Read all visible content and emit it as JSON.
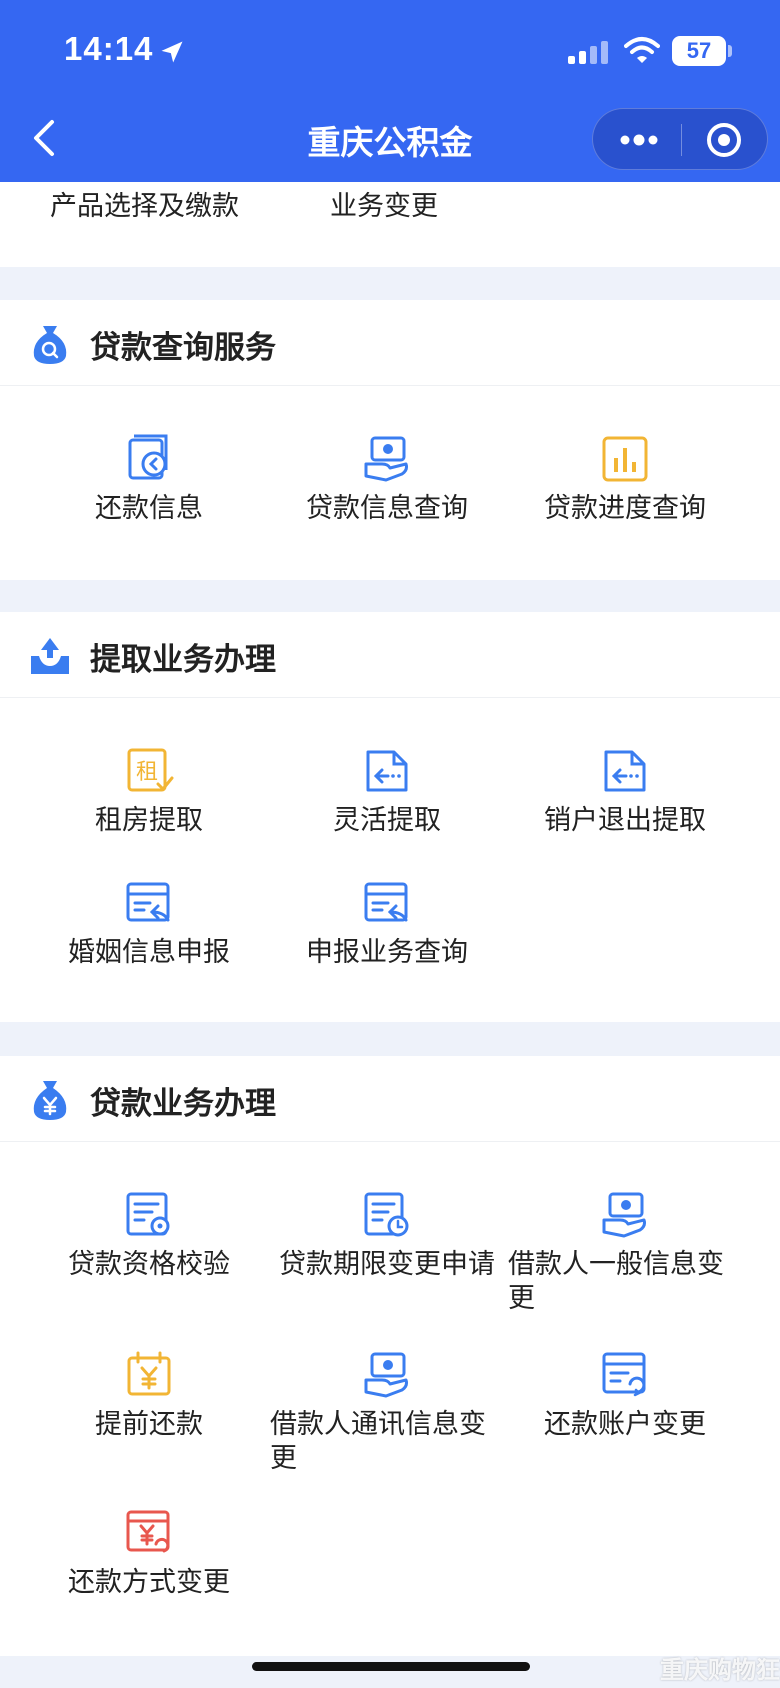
{
  "status_bar": {
    "time": "14:14",
    "battery": "57",
    "location_icon": "location-arrow-icon",
    "signal_icon": "cellular-signal-icon",
    "wifi_icon": "wifi-icon"
  },
  "nav": {
    "title": "重庆公积金",
    "back_icon": "chevron-left-icon",
    "more_icon": "more-dots-icon",
    "close_icon": "target-circle-icon"
  },
  "top_items": [
    "产品选择及缴款",
    "业务变更"
  ],
  "sections": [
    {
      "title": "贷款查询服务",
      "icon": "money-bag-search-icon",
      "items": [
        {
          "label": "还款信息",
          "icon": "repay-info-icon"
        },
        {
          "label": "贷款信息查询",
          "icon": "loan-hand-card-icon"
        },
        {
          "label": "贷款进度查询",
          "icon": "bar-chart-icon"
        }
      ]
    },
    {
      "title": "提取业务办理",
      "icon": "withdraw-tray-icon",
      "items": [
        {
          "label": "租房提取",
          "icon": "rent-check-icon"
        },
        {
          "label": "灵活提取",
          "icon": "document-arrow-icon"
        },
        {
          "label": "销户退出提取",
          "icon": "document-arrow-icon"
        },
        {
          "label": "婚姻信息申报",
          "icon": "form-return-icon"
        },
        {
          "label": "申报业务查询",
          "icon": "form-return-icon"
        }
      ]
    },
    {
      "title": "贷款业务办理",
      "icon": "money-bag-yuan-icon",
      "items": [
        {
          "label": "贷款资格校验",
          "icon": "form-gear-icon"
        },
        {
          "label": "贷款期限变更申请",
          "icon": "document-clock-icon"
        },
        {
          "label": "借款人一般信息变更",
          "icon": "loan-hand-card-icon"
        },
        {
          "label": "提前还款",
          "icon": "calendar-yuan-icon"
        },
        {
          "label": "借款人通讯信息变更",
          "icon": "loan-hand-card-icon"
        },
        {
          "label": "还款账户变更",
          "icon": "form-refresh-icon"
        },
        {
          "label": "还款方式变更",
          "icon": "yuan-refresh-icon"
        }
      ]
    }
  ],
  "colors": {
    "brand_blue": "#3567f2",
    "icon_blue": "#3a7df0",
    "icon_yellow": "#f2b534",
    "icon_red": "#e8574e",
    "page_bg": "#eef2fa"
  },
  "watermark": "重庆购物狂"
}
